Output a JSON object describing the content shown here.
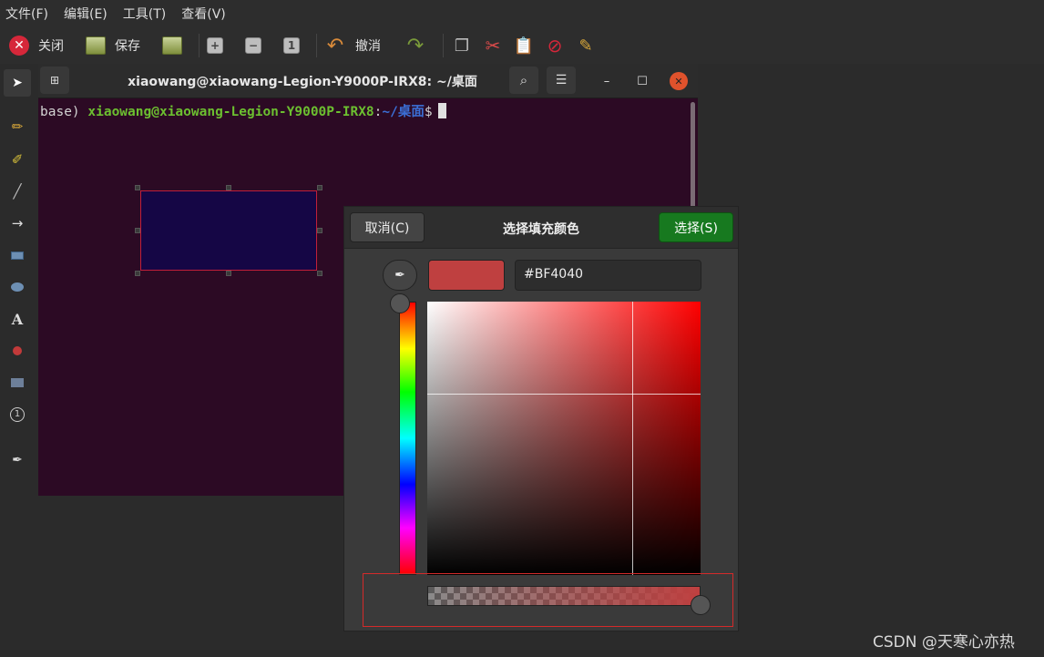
{
  "menu": [
    "文件(F)",
    "编辑(E)",
    "工具(T)",
    "查看(V)"
  ],
  "toolbar": {
    "close_label": "关闭",
    "save_label": "保存",
    "undo_label": "撤消"
  },
  "terminal": {
    "title": "xiaowang@xiaowang-Legion-Y9000P-IRX8: ~/桌面",
    "prompt_prefix": "base)",
    "prompt_user": "xiaowang@xiaowang-Legion-Y9000P-IRX8",
    "prompt_sep": ":",
    "prompt_path": "~/桌面",
    "prompt_symbol": "$"
  },
  "dialog": {
    "cancel_label": "取消(C)",
    "title": "选择填充颜色",
    "select_label": "选择(S)",
    "hex_value": "#BF4040",
    "current_color": "#BF4040"
  },
  "watermark": "CSDN @天寒心亦热"
}
